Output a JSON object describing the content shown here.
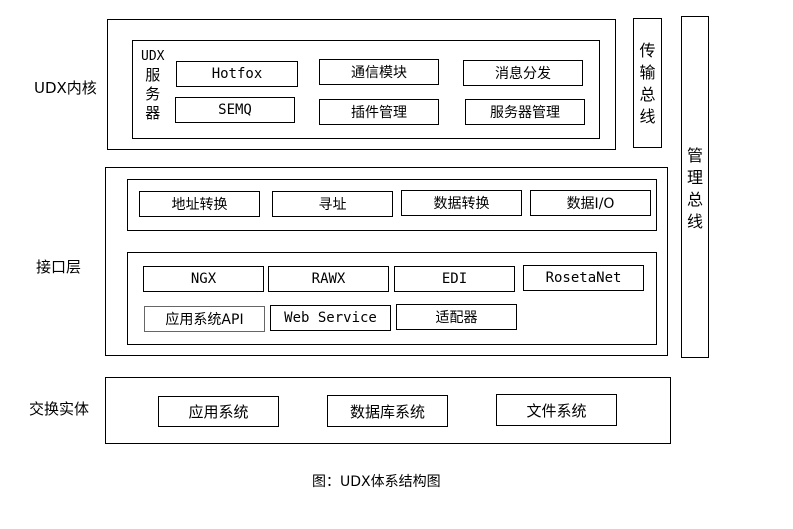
{
  "layers": {
    "kernel": {
      "label": "UDX内核",
      "server_group": {
        "label_lines": [
          "UDX",
          "服",
          "务",
          "器"
        ],
        "modules": [
          "Hotfox",
          "通信模块",
          "消息分发",
          "SEMQ",
          "插件管理",
          "服务器管理"
        ]
      }
    },
    "interface": {
      "label": "接口层",
      "top_group": [
        "地址转换",
        "寻址",
        "数据转换",
        "数据I/O"
      ],
      "bottom_group": {
        "row1": [
          "NGX",
          "RAWX",
          "EDI",
          "RosetaNet"
        ],
        "row2": [
          "应用系统API",
          "Web Service",
          "适配器"
        ]
      }
    },
    "exchange": {
      "label": "交换实体",
      "items": [
        "应用系统",
        "数据库系统",
        "文件系统"
      ]
    }
  },
  "buses": {
    "transport": [
      "传",
      "输",
      "总",
      "线"
    ],
    "management": [
      "管",
      "理",
      "总",
      "线"
    ]
  },
  "caption": "图：UDX体系结构图"
}
